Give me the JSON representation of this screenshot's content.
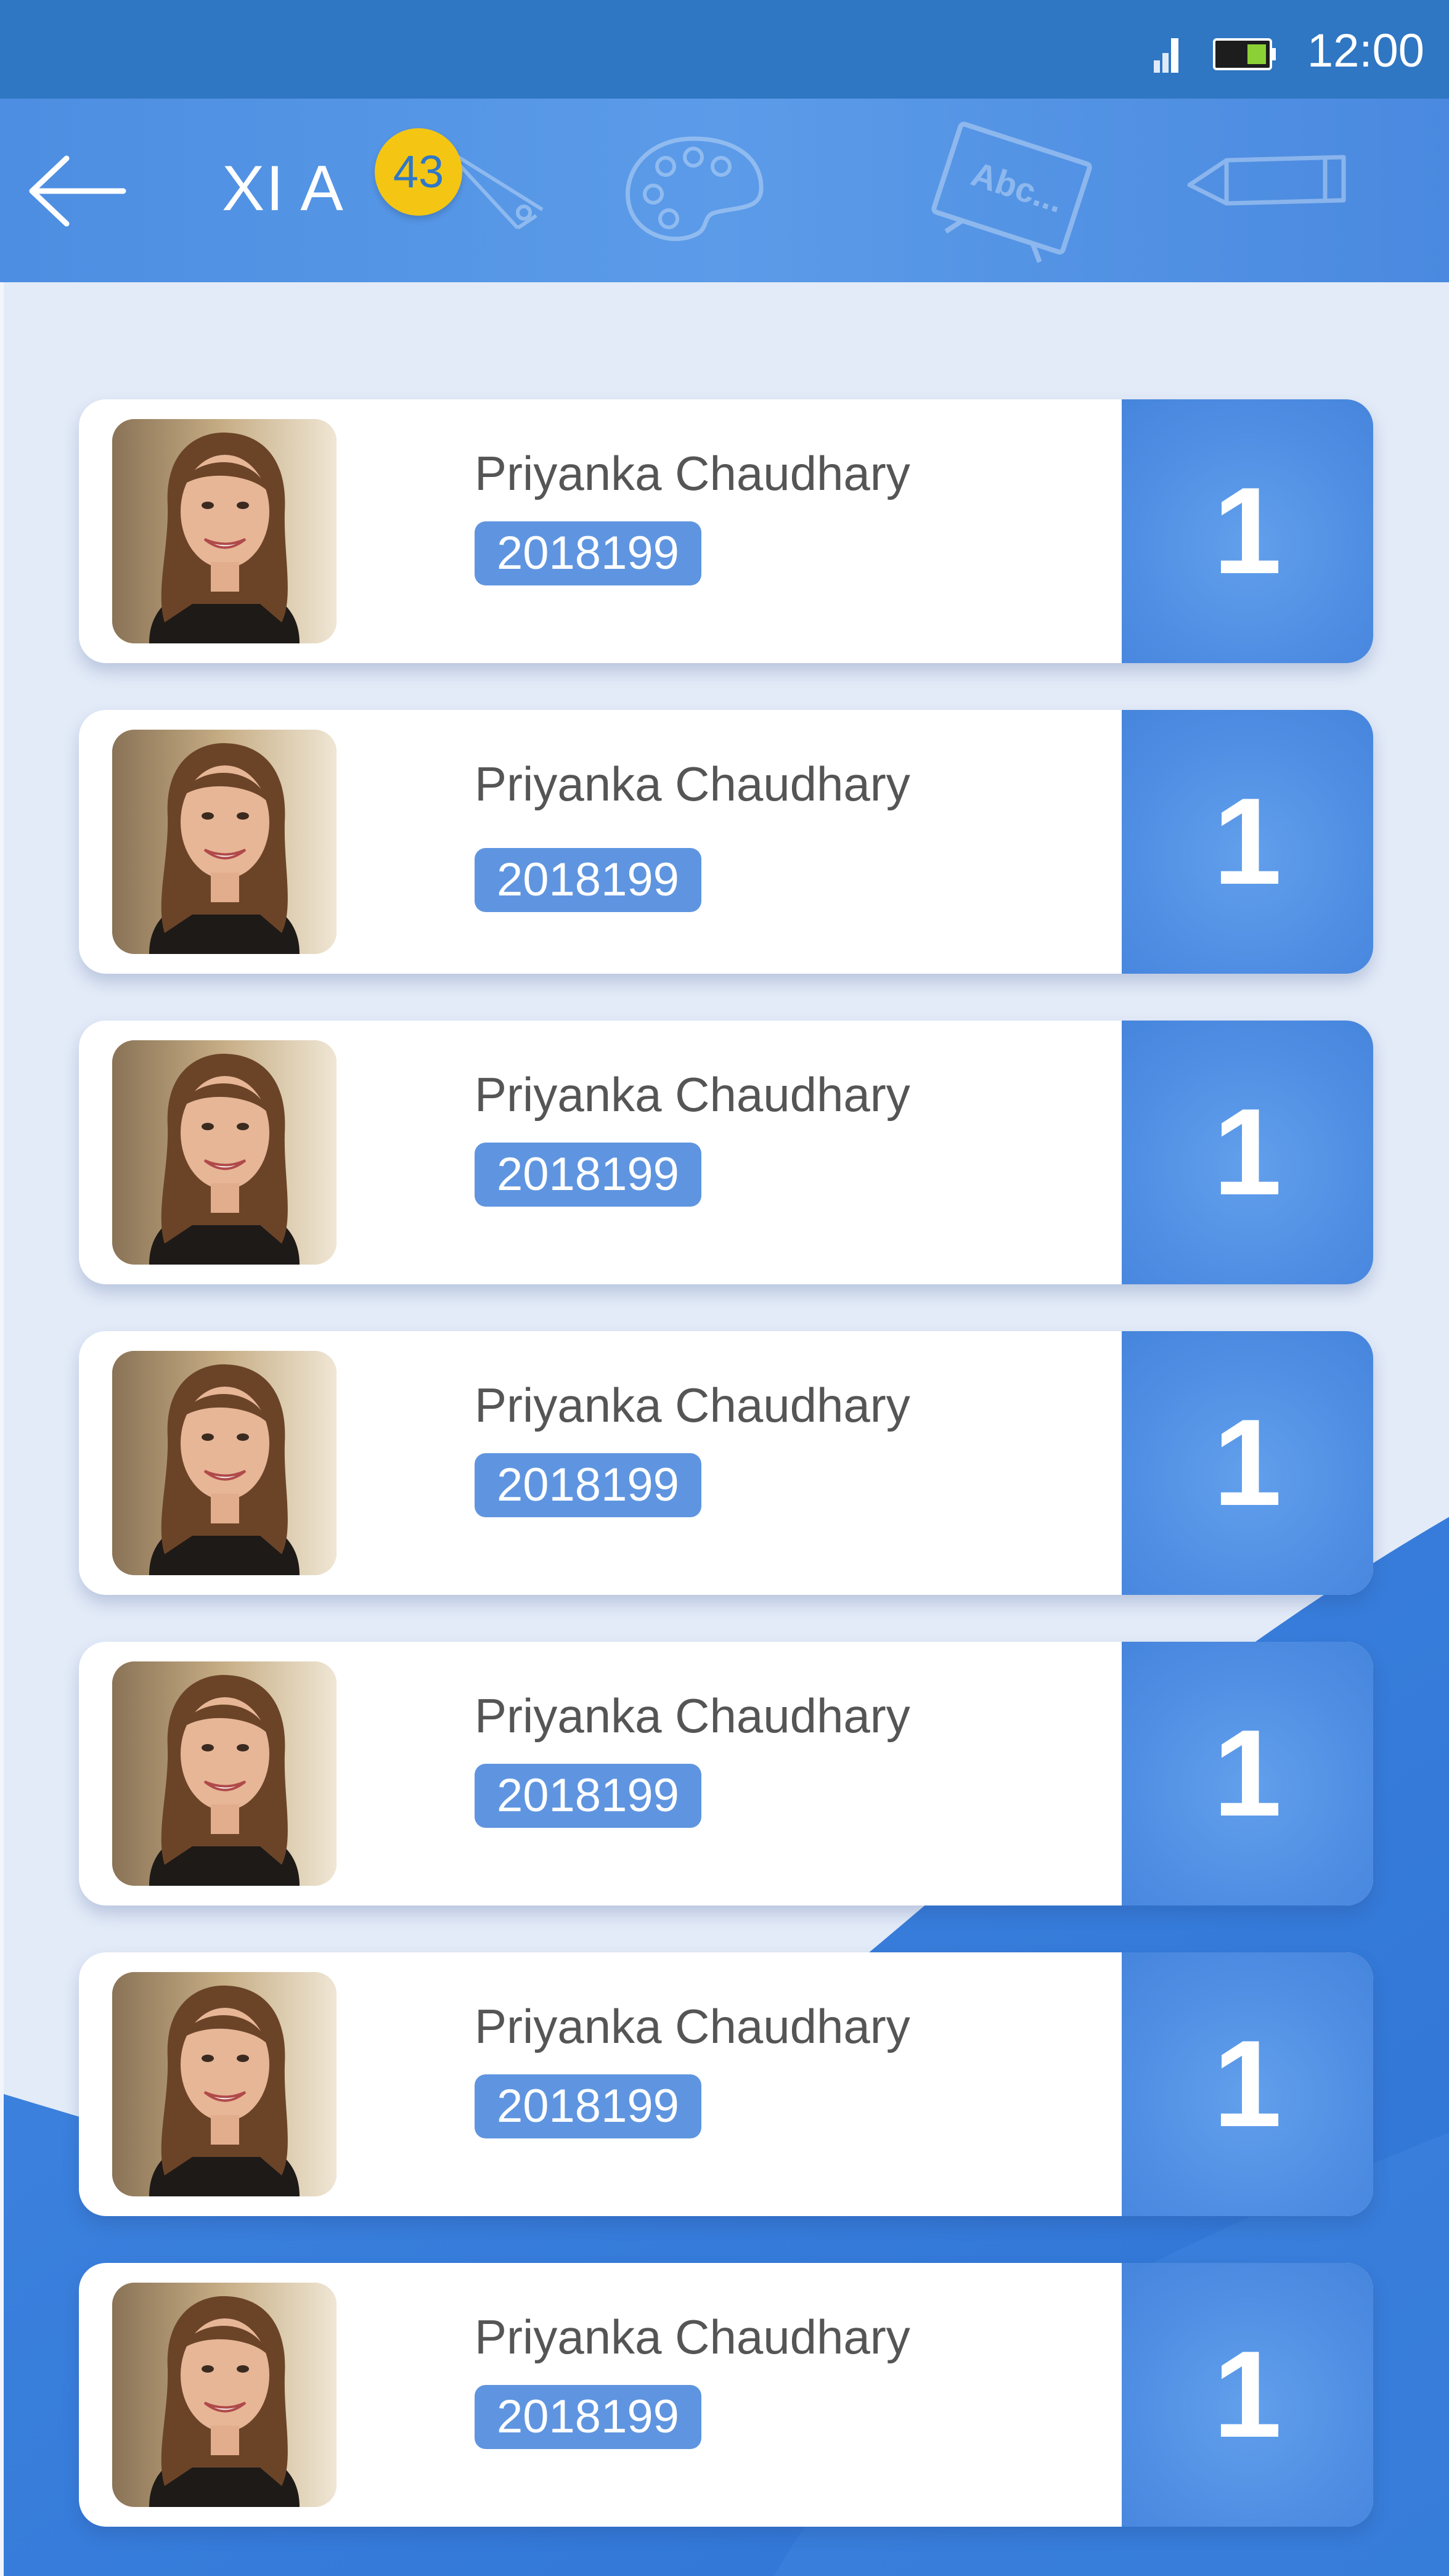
{
  "status_bar": {
    "time": "12:00",
    "icons": [
      "signal-icon",
      "battery-icon"
    ]
  },
  "header": {
    "back_icon": "arrow-left-icon",
    "title": "XI A",
    "count_badge": "43",
    "decorations": [
      "compass-icon",
      "palette-icon",
      "chalkboard-icon",
      "pencil-icon"
    ],
    "chalkboard_text": "Abc..."
  },
  "colors": {
    "status_bar": "#2f76c3",
    "header": "#5597e6",
    "badge": "#f4c613",
    "accent": "#4f8ee3",
    "background": "#e3ebf8"
  },
  "students": [
    {
      "name": "Priyanka Chaudhary",
      "id": "2018199",
      "roll": "1"
    },
    {
      "name": "Priyanka Chaudhary",
      "id": "2018199",
      "roll": "1"
    },
    {
      "name": "Priyanka Chaudhary",
      "id": "2018199",
      "roll": "1"
    },
    {
      "name": "Priyanka Chaudhary",
      "id": "2018199",
      "roll": "1"
    },
    {
      "name": "Priyanka Chaudhary",
      "id": "2018199",
      "roll": "1"
    },
    {
      "name": "Priyanka Chaudhary",
      "id": "2018199",
      "roll": "1"
    },
    {
      "name": "Priyanka Chaudhary",
      "id": "2018199",
      "roll": "1"
    }
  ]
}
